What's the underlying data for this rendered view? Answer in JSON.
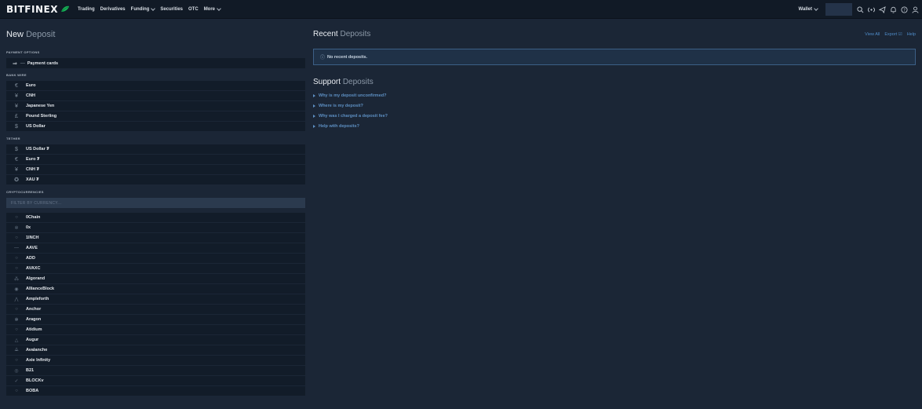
{
  "brand": {
    "logo_text": "BITFINEX",
    "accent": "#16b157"
  },
  "nav": [
    {
      "label": "Trading",
      "dropdown": false
    },
    {
      "label": "Derivatives",
      "dropdown": false
    },
    {
      "label": "Funding",
      "dropdown": true
    },
    {
      "label": "Securities",
      "dropdown": false
    },
    {
      "label": "OTC",
      "dropdown": false
    },
    {
      "label": "More",
      "dropdown": true
    }
  ],
  "header_right": {
    "wallet_label": "Wallet",
    "icons": [
      "search-icon",
      "broadcast-icon",
      "telegram-icon",
      "bell-icon",
      "help-icon",
      "user-icon"
    ]
  },
  "left": {
    "title_strong": "New",
    "title_muted": "Deposit",
    "payment_label": "PAYMENT OPTIONS",
    "payment_item": "Payment cards",
    "bank_label": "BANK WIRE",
    "bank_items": [
      {
        "icon": "€",
        "label": "Euro"
      },
      {
        "icon": "¥",
        "label": "CNH"
      },
      {
        "icon": "¥",
        "label": "Japanese Yen"
      },
      {
        "icon": "£",
        "label": "Pound Sterling"
      },
      {
        "icon": "$",
        "label": "US Dollar"
      }
    ],
    "tether_label": "TETHER",
    "tether_items": [
      {
        "icon": "$",
        "label": "US Dollar ₮"
      },
      {
        "icon": "€",
        "label": "Euro ₮"
      },
      {
        "icon": "¥",
        "label": "CNH ₮"
      },
      {
        "icon": "✪",
        "label": "XAU ₮"
      }
    ],
    "crypto_label": "CRYPTOCURRENCIES",
    "filter_placeholder": "FILTER BY CURRENCY...",
    "crypto_items": [
      {
        "icon": "○",
        "label": "0Chain"
      },
      {
        "icon": "✲",
        "label": "0x"
      },
      {
        "icon": "○",
        "label": "1INCH"
      },
      {
        "icon": "—",
        "label": "AAVE"
      },
      {
        "icon": "○",
        "label": "ADD"
      },
      {
        "icon": "○",
        "label": "AVAXC"
      },
      {
        "icon": "⁂",
        "label": "Algorand"
      },
      {
        "icon": "◉",
        "label": "AllianceBlock"
      },
      {
        "icon": "⋀",
        "label": "Ampleforth"
      },
      {
        "icon": "○",
        "label": "Anchor"
      },
      {
        "icon": "❃",
        "label": "Aragon"
      },
      {
        "icon": "○",
        "label": "Atidium"
      },
      {
        "icon": "△",
        "label": "Augur"
      },
      {
        "icon": "⟁",
        "label": "Avalanche"
      },
      {
        "icon": "○",
        "label": "Axie Infinity"
      },
      {
        "icon": "◎",
        "label": "B21"
      },
      {
        "icon": "✓",
        "label": "BLOCKv"
      },
      {
        "icon": "○",
        "label": "BOBA"
      }
    ]
  },
  "right": {
    "recent_strong": "Recent",
    "recent_muted": "Deposits",
    "links": [
      "View All",
      "Export ☑",
      "Help"
    ],
    "no_recent": "No recent deposits.",
    "support_strong": "Support",
    "support_muted": "Deposits",
    "faqs": [
      "Why is my deposit unconfirmed?",
      "Where is my deposit?",
      "Why was I charged a deposit fee?",
      "Help with deposits?"
    ]
  }
}
